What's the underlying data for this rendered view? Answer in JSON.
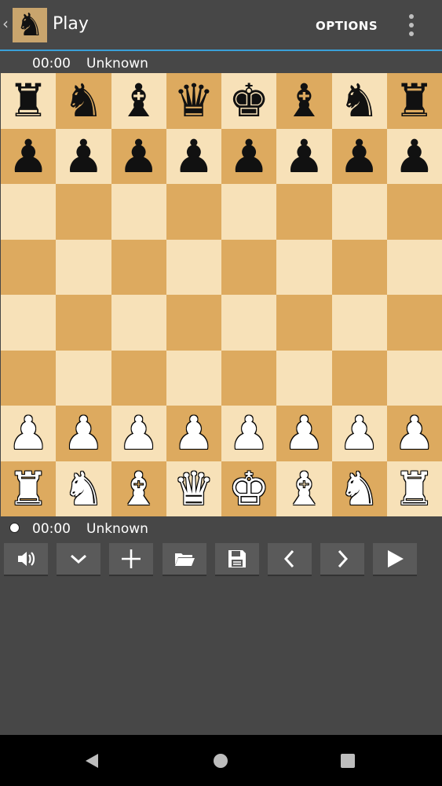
{
  "app": {
    "title": "Play",
    "options_label": "OPTIONS",
    "back_glyph": "‹",
    "logo_glyph": "♞"
  },
  "top_player": {
    "time": "00:00",
    "name": "Unknown"
  },
  "bottom_player": {
    "time": "00:00",
    "name": "Unknown",
    "to_move": true
  },
  "board": {
    "light_color": "#f7e1b8",
    "dark_color": "#ddaa5f",
    "ranks": [
      [
        "r",
        "n",
        "b",
        "q",
        "k",
        "b",
        "n",
        "r"
      ],
      [
        "p",
        "p",
        "p",
        "p",
        "p",
        "p",
        "p",
        "p"
      ],
      [
        "",
        "",
        "",
        "",
        "",
        "",
        "",
        ""
      ],
      [
        "",
        "",
        "",
        "",
        "",
        "",
        "",
        ""
      ],
      [
        "",
        "",
        "",
        "",
        "",
        "",
        "",
        ""
      ],
      [
        "",
        "",
        "",
        "",
        "",
        "",
        "",
        ""
      ],
      [
        "P",
        "P",
        "P",
        "P",
        "P",
        "P",
        "P",
        "P"
      ],
      [
        "R",
        "N",
        "B",
        "Q",
        "K",
        "B",
        "N",
        "R"
      ]
    ]
  },
  "toolbar": [
    {
      "name": "sound-button",
      "icon": "speaker-icon"
    },
    {
      "name": "dropdown-button",
      "icon": "chevron-down-icon"
    },
    {
      "name": "new-game-button",
      "icon": "plus-icon"
    },
    {
      "name": "open-button",
      "icon": "folder-icon"
    },
    {
      "name": "save-button",
      "icon": "floppy-icon"
    },
    {
      "name": "previous-move-button",
      "icon": "chevron-left-icon"
    },
    {
      "name": "next-move-button",
      "icon": "chevron-right-icon"
    },
    {
      "name": "play-button",
      "icon": "play-icon"
    }
  ],
  "colors": {
    "accent": "#3aa0d8",
    "background": "#474747",
    "button": "#5a5a5a"
  }
}
